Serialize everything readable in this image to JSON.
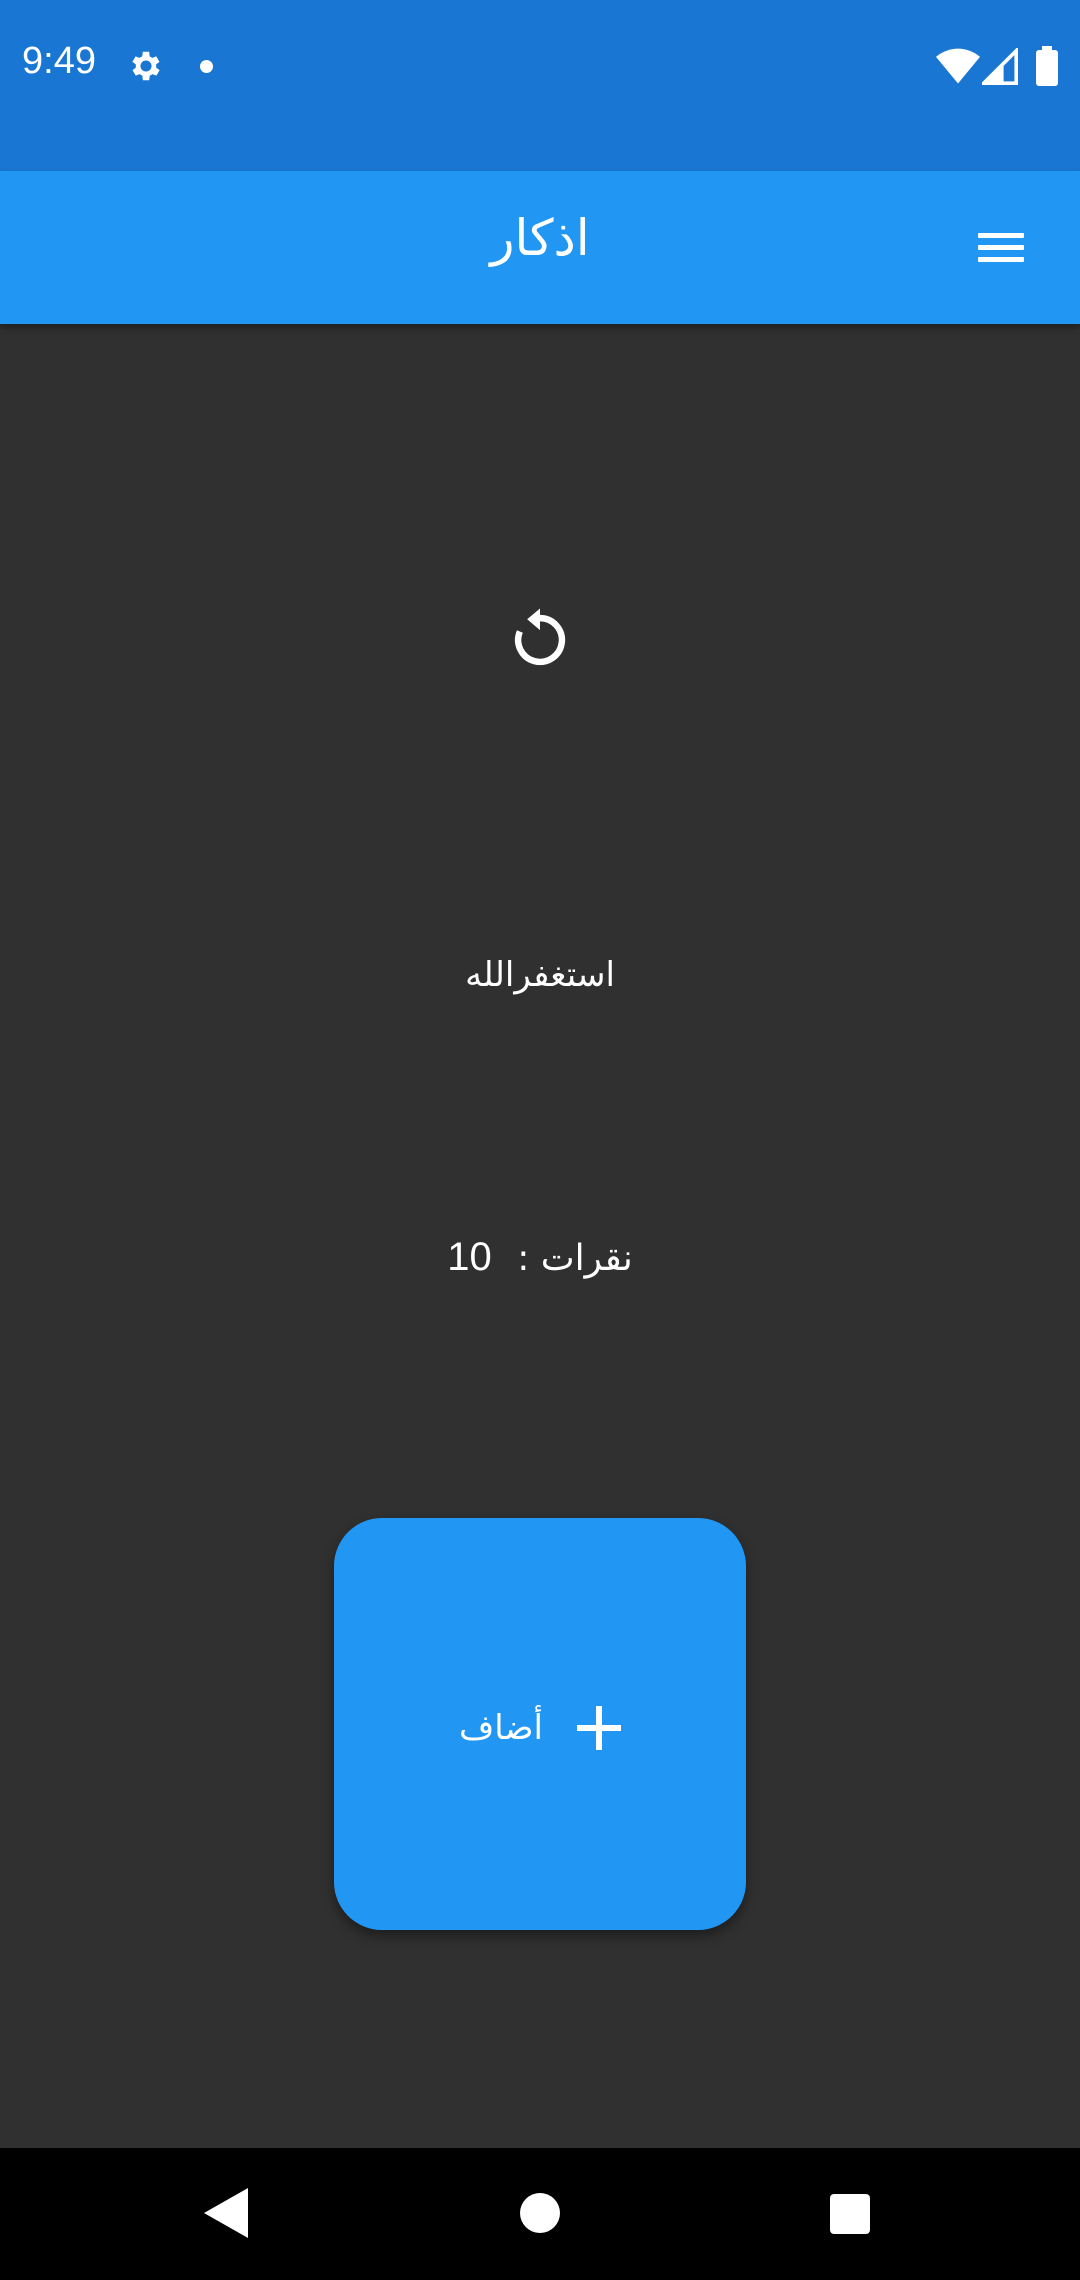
{
  "status_bar": {
    "time": "9:49",
    "icons": [
      "gear-icon",
      "notification-dot-icon",
      "wifi-icon",
      "signal-icon",
      "battery-icon"
    ]
  },
  "app_bar": {
    "title": "اذكار",
    "menu_icon": "hamburger-menu-icon"
  },
  "main": {
    "reset_icon": "refresh-icon",
    "dhikr_text": "استغفرالله",
    "count_label": "نقرات :",
    "count_value": "10",
    "add_button": {
      "label": "أضاف",
      "icon": "plus-icon"
    }
  },
  "nav_bar": {
    "icons": [
      "back-icon",
      "home-icon",
      "recents-icon"
    ]
  },
  "colors": {
    "status_bar": "#1976d2",
    "app_bar": "#2196f3",
    "background": "#303030",
    "accent": "#2196f3",
    "nav_bar": "#000000"
  }
}
